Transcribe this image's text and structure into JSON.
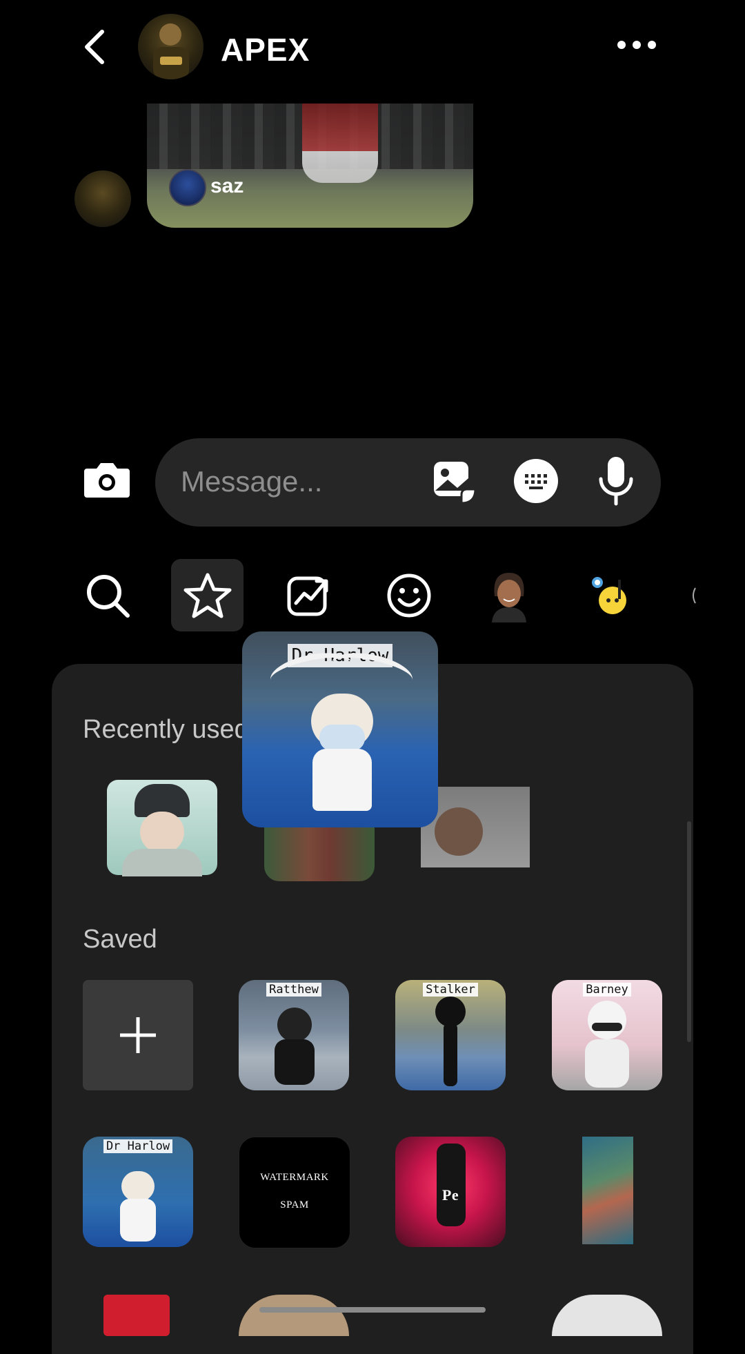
{
  "header": {
    "back_icon": "chevron-left-icon",
    "title": "APEX",
    "more_icon": "more-horizontal-icon"
  },
  "shared_post": {
    "username": "saz"
  },
  "composer": {
    "placeholder": "Message...",
    "camera_icon": "camera-icon",
    "gallery_icon": "gallery-sticker-icon",
    "keyboard_icon": "keyboard-icon",
    "mic_icon": "microphone-icon"
  },
  "sticker_tabs": [
    {
      "icon": "search-icon",
      "selected": false
    },
    {
      "icon": "star-icon",
      "selected": true
    },
    {
      "icon": "trending-icon",
      "selected": false
    },
    {
      "icon": "smile-icon",
      "selected": false
    },
    {
      "icon": "avatar-icon",
      "selected": false
    },
    {
      "icon": "music-sticker-icon",
      "selected": false
    }
  ],
  "preview": {
    "label": "Dr Harlow"
  },
  "sections": {
    "recent": "Recently used",
    "saved": "Saved"
  },
  "saved_stickers": [
    {
      "label": "Ratthew"
    },
    {
      "label": "Stalker"
    },
    {
      "label": "Barney"
    },
    {
      "label": "Dr Harlow"
    },
    {
      "text_line1": "WATERMARK",
      "text_line2": "SPAM"
    },
    {
      "text": "Pe"
    }
  ],
  "colors": {
    "background": "#000000",
    "panel": "#1f1f1f",
    "composer": "#262626",
    "placeholder": "#8e8e8e"
  }
}
